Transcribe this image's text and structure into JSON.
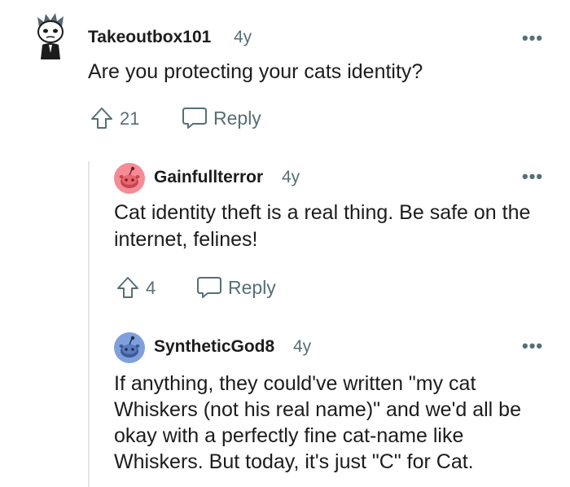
{
  "comments": [
    {
      "username": "Takeoutbox101",
      "age": "4y",
      "menu": "•••",
      "body": "Are you protecting your cats identity?",
      "score": "21",
      "reply_label": "Reply"
    },
    {
      "username": "Gainfullterror",
      "age": "4y",
      "menu": "•••",
      "body": "Cat identity theft is a real thing. Be safe on the internet, felines!",
      "score": "4",
      "reply_label": "Reply"
    },
    {
      "username": "SyntheticGod8",
      "age": "4y",
      "menu": "•••",
      "body": "If anything, they could've written \"my cat Whiskers (not his real name)\" and we'd all be okay with a perfectly fine cat-name like Whiskers. But today, it's just \"C\" for Cat."
    }
  ],
  "icons": {
    "upvote": "upvote-arrow-icon",
    "reply": "speech-bubble-icon",
    "avatar": "snoo-avatar-icon"
  },
  "colors": {
    "meta_text": "#576f76",
    "avatar_pink": "#f48b95",
    "avatar_blue": "#7f9fdd",
    "thread_line": "#e3e6e8"
  }
}
